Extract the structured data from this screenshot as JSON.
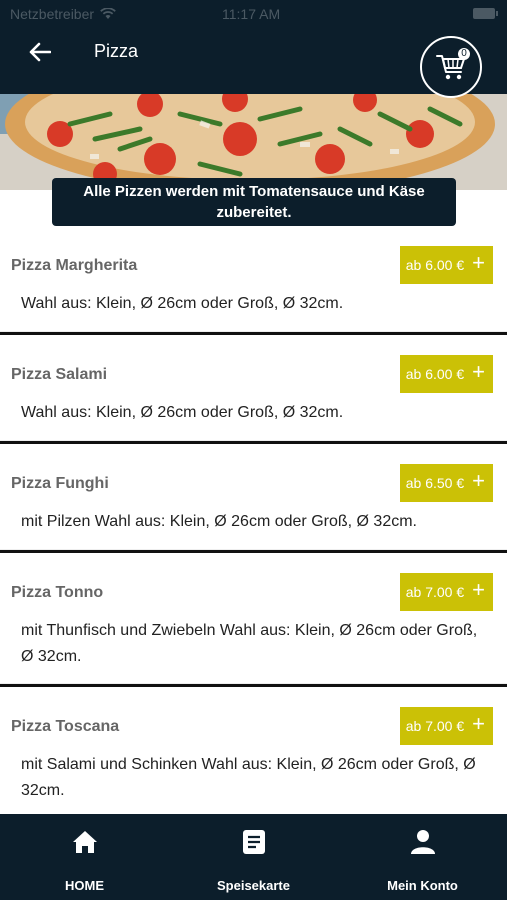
{
  "status_bar": {
    "carrier": "Netzbetreiber",
    "time": "11:17 AM"
  },
  "header": {
    "title": "Pizza",
    "cart_count": "0"
  },
  "banner": {
    "line1": "Alle Pizzen werden mit Tomatensauce und Käse",
    "line2": "zubereitet."
  },
  "items": [
    {
      "name": "Pizza Margherita",
      "price": "ab 6.00 €",
      "desc1": "Wahl aus: Klein, Ø 26cm oder Groß, Ø 32cm.",
      "desc2": ""
    },
    {
      "name": "Pizza Salami",
      "price": "ab 6.00 €",
      "desc1": "Wahl aus: Klein, Ø 26cm oder Groß, Ø 32cm.",
      "desc2": ""
    },
    {
      "name": "Pizza Funghi",
      "price": "ab 6.50 €",
      "desc1": "mit Pilzen Wahl aus: Klein, Ø 26cm oder Groß, Ø 32cm.",
      "desc2": ""
    },
    {
      "name": "Pizza Tonno",
      "price": "ab 7.00 €",
      "desc1": "mit Thunfisch und Zwiebeln Wahl aus: Klein, Ø 26cm oder Groß,",
      "desc2": "Ø 32cm."
    },
    {
      "name": "Pizza Toscana",
      "price": "ab 7.00 €",
      "desc1": "mit Salami und Schinken Wahl aus: Klein, Ø 26cm oder Groß, Ø",
      "desc2": "32cm."
    }
  ],
  "tabs": {
    "home": "HOME",
    "menu": "Speisekarte",
    "account": "Mein Konto"
  },
  "colors": {
    "dark": "#0c1e2b",
    "accent": "#cbc106"
  }
}
